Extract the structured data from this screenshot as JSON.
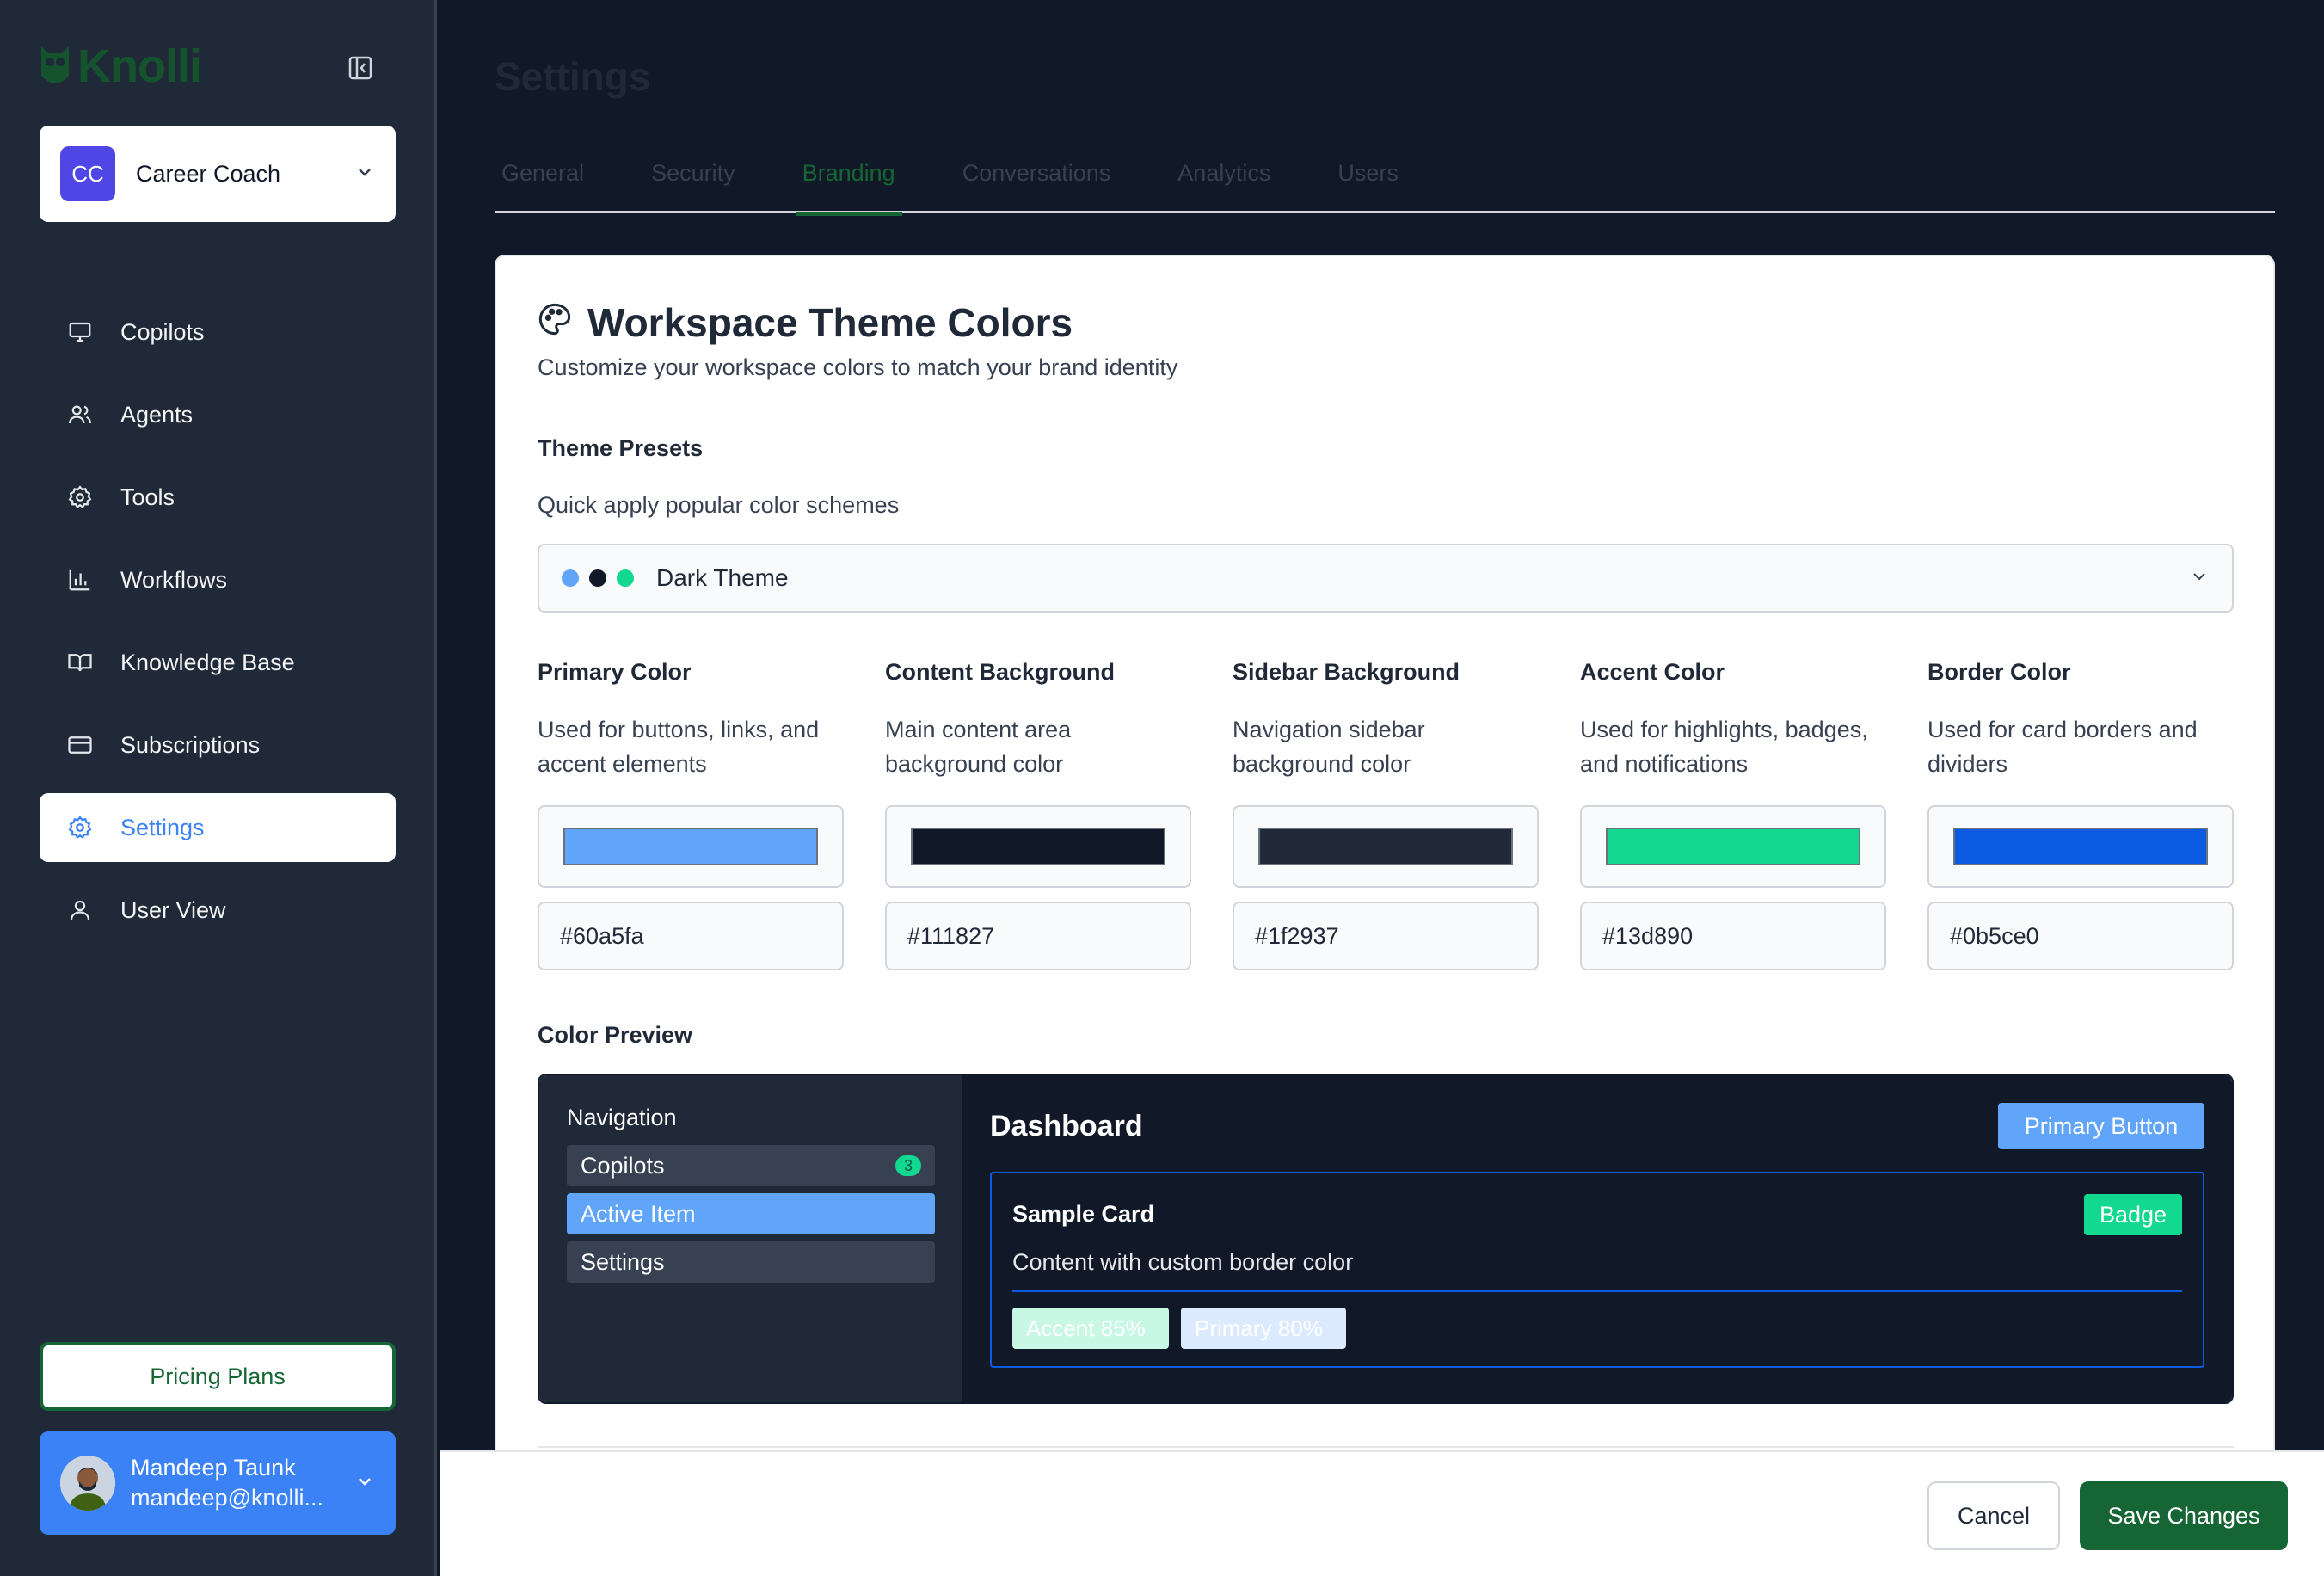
{
  "brand": {
    "name": "Knolli",
    "icon": "owl-logo-icon"
  },
  "workspace": {
    "initials": "CC",
    "name": "Career Coach"
  },
  "nav": [
    {
      "label": "Copilots",
      "icon": "monitor-icon"
    },
    {
      "label": "Agents",
      "icon": "users-icon"
    },
    {
      "label": "Tools",
      "icon": "gear-icon"
    },
    {
      "label": "Workflows",
      "icon": "bar-chart-icon"
    },
    {
      "label": "Knowledge Base",
      "icon": "book-icon"
    },
    {
      "label": "Subscriptions",
      "icon": "credit-card-icon"
    },
    {
      "label": "Settings",
      "icon": "gear-icon",
      "active": true
    },
    {
      "label": "User View",
      "icon": "user-icon"
    }
  ],
  "pricing_label": "Pricing Plans",
  "user": {
    "name": "Mandeep Taunk",
    "email": "mandeep@knolli..."
  },
  "page_title": "Settings",
  "tabs": [
    {
      "label": "General"
    },
    {
      "label": "Security"
    },
    {
      "label": "Branding",
      "active": true
    },
    {
      "label": "Conversations"
    },
    {
      "label": "Analytics"
    },
    {
      "label": "Users"
    }
  ],
  "theme": {
    "title": "Workspace Theme Colors",
    "subtitle": "Customize your workspace colors to match your brand identity",
    "presets_title": "Theme Presets",
    "presets_desc": "Quick apply popular color schemes",
    "preset_selected": "Dark Theme",
    "preset_dots": [
      "#60a5fa",
      "#111827",
      "#13d890"
    ],
    "colors": [
      {
        "title": "Primary Color",
        "desc": "Used for buttons, links, and accent elements",
        "hex": "#60a5fa"
      },
      {
        "title": "Content Background",
        "desc": "Main content area background color",
        "hex": "#111827"
      },
      {
        "title": "Sidebar Background",
        "desc": "Navigation sidebar background color",
        "hex": "#1f2937"
      },
      {
        "title": "Accent Color",
        "desc": "Used for highlights, badges, and notifications",
        "hex": "#13d890"
      },
      {
        "title": "Border Color",
        "desc": "Used for card borders and dividers",
        "hex": "#0b5ce0"
      }
    ],
    "preview_title": "Color Preview",
    "preview": {
      "nav_title": "Navigation",
      "items": [
        {
          "label": "Copilots",
          "count": "3"
        },
        {
          "label": "Active Item"
        },
        {
          "label": "Settings"
        }
      ],
      "heading": "Dashboard",
      "primary_button": "Primary Button",
      "card_title": "Sample Card",
      "badge": "Badge",
      "card_text": "Content with custom border color",
      "chip_accent": "Accent 85%",
      "chip_primary": "Primary 80%"
    }
  },
  "footer": {
    "cancel": "Cancel",
    "save": "Save Changes"
  }
}
